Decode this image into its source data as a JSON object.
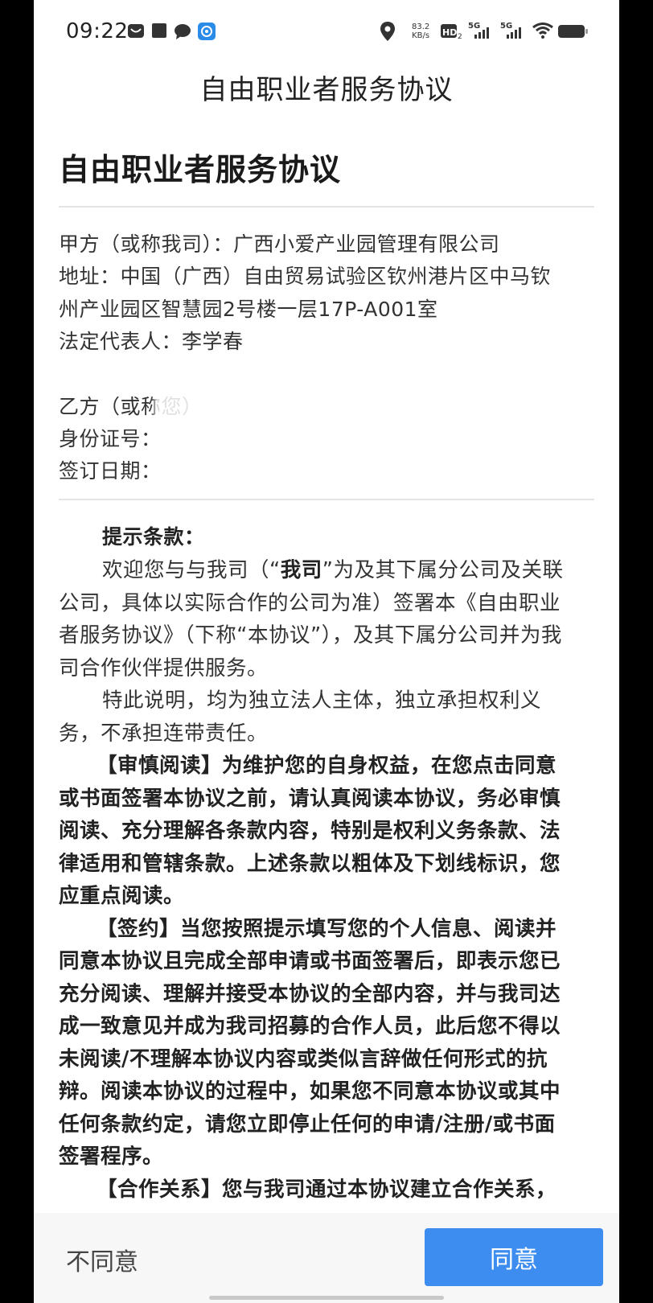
{
  "status_bar": {
    "time": "09:22",
    "net_speed_value": "83.2",
    "net_speed_unit": "KB/s",
    "signal_1": "5G",
    "signal_2": "5G",
    "hd_label": "HD"
  },
  "nav": {
    "title": "自由职业者服务协议"
  },
  "document": {
    "title": "自由职业者服务协议",
    "party_a": {
      "line1": "甲方（或称我司）：广西小爱产业园管理有限公司",
      "line2": "地址：中国（广西）自由贸易试验区钦州港片区中马钦",
      "line3": "州产业园区智慧园2号楼一层17P-A001室",
      "line4": "法定代表人：李学春"
    },
    "party_b": {
      "name_label": "乙方（或称您）",
      "id_label": "身份证号：",
      "date_label": "签订日期："
    },
    "notice_heading": "提示条款：",
    "para1": {
      "l1_a": "欢迎您与与我司（“",
      "l1_b": "我司",
      "l1_c": "”为及其下属分公司及关联",
      "l2": "公司，具体以实际合作的公司为准）签署本《自由职业",
      "l3": "者服务协议》（下称“本协议”），及其下属分公司并为我",
      "l4": "司合作伙伴提供服务。"
    },
    "para2": {
      "l1": "特此说明，均为独立法人主体，独立承担权利义",
      "l2": "务，不承担连带责任。"
    },
    "para3": {
      "l1": "【审慎阅读】为维护您的自身权益，在您点击同意",
      "l2": "或书面签署本协议之前，请认真阅读本协议，务必审慎",
      "l3": "阅读、充分理解各条款内容，特别是权利义务条款、法",
      "l4": "律适用和管辖条款。上述条款以粗体及下划线标识，您",
      "l5": "应重点阅读。"
    },
    "para4": {
      "l1": "【签约】当您按照提示填写您的个人信息、阅读并",
      "l2": "同意本协议且完成全部申请或书面签署后，即表示您已",
      "l3": "充分阅读、理解并接受本协议的全部内容，并与我司达",
      "l4": "成一致意见并成为我司招募的合作人员，此后您不得以",
      "l5": "未阅读/不理解本协议内容或类似言辞做任何形式的抗",
      "l6": "辩。阅读本协议的过程中，如果您不同意本协议或其中",
      "l7": "任何条款约定，请您立即停止任何的申请/注册/或书面",
      "l8": "签署程序。"
    },
    "para5": {
      "l1": "【合作关系】您与我司通过本协议建立合作关系，"
    }
  },
  "actions": {
    "disagree": "不同意",
    "agree": "同意"
  },
  "colors": {
    "accent": "#3d8cf0",
    "bottom_bar": "#f7f7f7"
  }
}
